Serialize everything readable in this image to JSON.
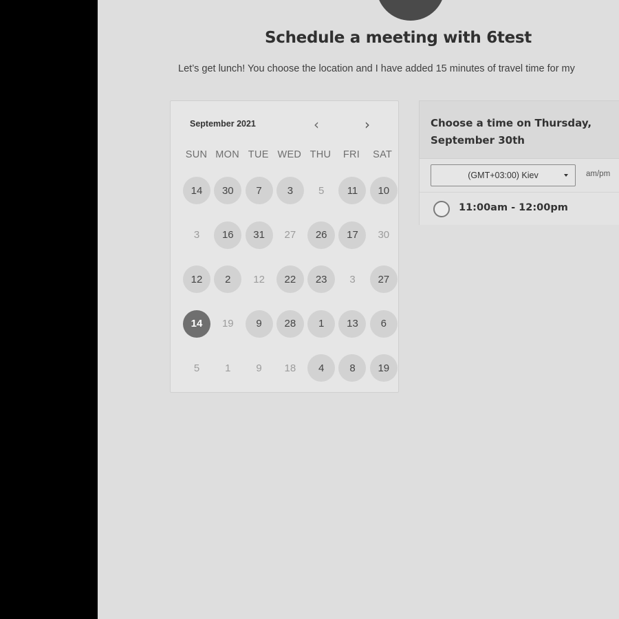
{
  "header": {
    "title": "Schedule a meeting with 6test",
    "description": "Let’s get lunch! You choose the location and I have added 15 minutes of travel time for my"
  },
  "calendar": {
    "month_label": "September 2021",
    "prev_icon": "‹",
    "next_icon": "›",
    "weekdays": [
      "SUN",
      "MON",
      "TUE",
      "WED",
      "THU",
      "FRI",
      "SAT"
    ],
    "weeks": [
      [
        {
          "label": "14",
          "available": true
        },
        {
          "label": "30",
          "available": true
        },
        {
          "label": "7",
          "available": true
        },
        {
          "label": "3",
          "available": true
        },
        {
          "label": "5",
          "available": false
        },
        {
          "label": "11",
          "available": true
        },
        {
          "label": "10",
          "available": true
        }
      ],
      [
        {
          "label": "3",
          "available": false
        },
        {
          "label": "16",
          "available": true
        },
        {
          "label": "31",
          "available": true
        },
        {
          "label": "27",
          "available": false
        },
        {
          "label": "26",
          "available": true
        },
        {
          "label": "17",
          "available": true
        },
        {
          "label": "30",
          "available": false
        }
      ],
      [
        {
          "label": "12",
          "available": true
        },
        {
          "label": "2",
          "available": true
        },
        {
          "label": "12",
          "available": false
        },
        {
          "label": "22",
          "available": true
        },
        {
          "label": "23",
          "available": true
        },
        {
          "label": "3",
          "available": false
        },
        {
          "label": "27",
          "available": true
        }
      ],
      [
        {
          "label": "14",
          "available": true,
          "selected": true
        },
        {
          "label": "19",
          "available": false
        },
        {
          "label": "9",
          "available": true
        },
        {
          "label": "28",
          "available": true
        },
        {
          "label": "1",
          "available": true
        },
        {
          "label": "13",
          "available": true
        },
        {
          "label": "6",
          "available": true
        }
      ],
      [
        {
          "label": "5",
          "available": false
        },
        {
          "label": "1",
          "available": false
        },
        {
          "label": "9",
          "available": false
        },
        {
          "label": "18",
          "available": false
        },
        {
          "label": "4",
          "available": true
        },
        {
          "label": "8",
          "available": true
        },
        {
          "label": "19",
          "available": true
        }
      ]
    ]
  },
  "time_panel": {
    "heading": "Choose a time on Thursday, September 30th",
    "timezone": "(GMT+03:00) Kiev",
    "ampm_toggle": "am/pm",
    "slots": [
      {
        "label": "11:00am - 12:00pm",
        "selected": false
      }
    ]
  }
}
